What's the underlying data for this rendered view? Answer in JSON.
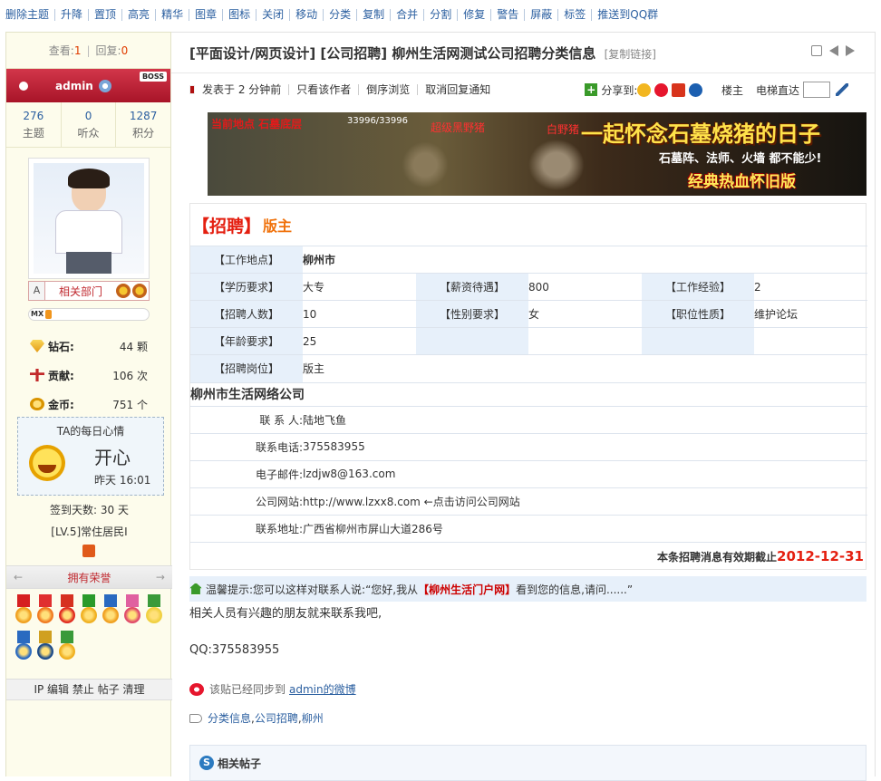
{
  "toolbar": {
    "items": [
      "删除主题",
      "升降",
      "置顶",
      "高亮",
      "精华",
      "图章",
      "图标",
      "关闭",
      "移动",
      "分类",
      "复制",
      "合并",
      "分割",
      "修复",
      "警告",
      "屏蔽",
      "标签",
      "推送到QQ群"
    ]
  },
  "sidebar": {
    "views_label": "查看:",
    "views": "1",
    "replies_label": "回复:",
    "replies": "0",
    "username": "admin",
    "boss_badge": "BOSS",
    "counts": [
      {
        "value": "276",
        "label": "主题"
      },
      {
        "value": "0",
        "label": "听众"
      },
      {
        "value": "1287",
        "label": "积分"
      }
    ],
    "dept_a": "A",
    "dept_label": "相关部门",
    "mx_label": "MX",
    "mx_fill_fraction": 0.06,
    "wealth": [
      {
        "key": "钻石:",
        "value": "44 颗",
        "icon": "diamond-icon"
      },
      {
        "key": "贡献:",
        "value": "106 次",
        "icon": "contribution-icon"
      },
      {
        "key": "金币:",
        "value": "751 个",
        "icon": "gold-coin-icon"
      }
    ],
    "mood_title": "TA的每日心情",
    "mood_text": "开心",
    "mood_time": "昨天 16:01",
    "signin": "签到天数: 30 天",
    "level": "[LV.5]常住居民I",
    "honor_title": "拥有荣誉",
    "admin_links": "IP 编辑 禁止 帖子 清理"
  },
  "post": {
    "title": "[平面设计/网页设计] [公司招聘] 柳州生活网测试公司招聘分类信息",
    "copy_link": "[复制链接]",
    "meta": {
      "posted": "发表于 2 分钟前",
      "only_author": "只看该作者",
      "reverse": "倒序浏览",
      "cancel_notify": "取消回复通知",
      "share_label": "分享到:",
      "floor_owner": "楼主",
      "elevator": "电梯直达"
    }
  },
  "banner": {
    "red1": "当前地点 石墓底层",
    "hp": "33996/33996",
    "red2": "超级黑野猪",
    "red3": "白野猪",
    "main": "一起怀念石墓烧猪的日子",
    "sub": "石墓阵、法师、火墙 都不能少!",
    "bottom": "经典热血怀旧版"
  },
  "job": {
    "recruit_label": "【招聘】",
    "position": "版主",
    "rows": [
      [
        {
          "k": "【工作地点】",
          "v": "柳州市",
          "bold": true
        }
      ],
      [
        {
          "k": "【学历要求】",
          "v": "大专"
        },
        {
          "k": "【薪资待遇】",
          "v": "800"
        },
        {
          "k": "【工作经验】",
          "v": "2"
        }
      ],
      [
        {
          "k": "【招聘人数】",
          "v": "10"
        },
        {
          "k": "【性别要求】",
          "v": "女"
        },
        {
          "k": "【职位性质】",
          "v": "维护论坛"
        }
      ],
      [
        {
          "k": "【年龄要求】",
          "v": "25"
        }
      ],
      [
        {
          "k": "【招聘岗位】",
          "v": "版主"
        }
      ]
    ],
    "company": "柳州市生活网络公司",
    "contacts": [
      {
        "k": "联 系 人:",
        "v": "陆地飞鱼"
      },
      {
        "k": "联系电话:",
        "v": "375583955"
      },
      {
        "k": "电子邮件:",
        "v": "lzdjw8@163.com"
      },
      {
        "k": "公司网站:",
        "v": "http://www.lzxx8.com ←点击访问公司网站"
      },
      {
        "k": "联系地址:",
        "v": "广西省柳州市屏山大道286号"
      }
    ],
    "expire_label": "本条招聘消息有效期截止",
    "expire_date": "2012-12-31"
  },
  "tip": {
    "prefix": "温馨提示:您可以这样对联系人说:“您好,我从",
    "site": "【柳州生活门户网】",
    "suffix": "看到您的信息,请问......”"
  },
  "body": {
    "line1": "相关人员有兴趣的朋友就来联系我吧,",
    "line2": "QQ:375583955"
  },
  "weibo": {
    "text": "该贴已经同步到",
    "link": "admin的微博"
  },
  "tags": {
    "items": [
      "分类信息",
      "公司招聘",
      "柳州"
    ]
  },
  "related": {
    "title": "相关帖子"
  },
  "colors": {
    "link_blue": "#2b5fa0",
    "recruit_red": "#e41f10",
    "position_orange": "#f0720c",
    "namebar_red": "#c0283e",
    "key_cell_bg": "#e7f0fa"
  }
}
